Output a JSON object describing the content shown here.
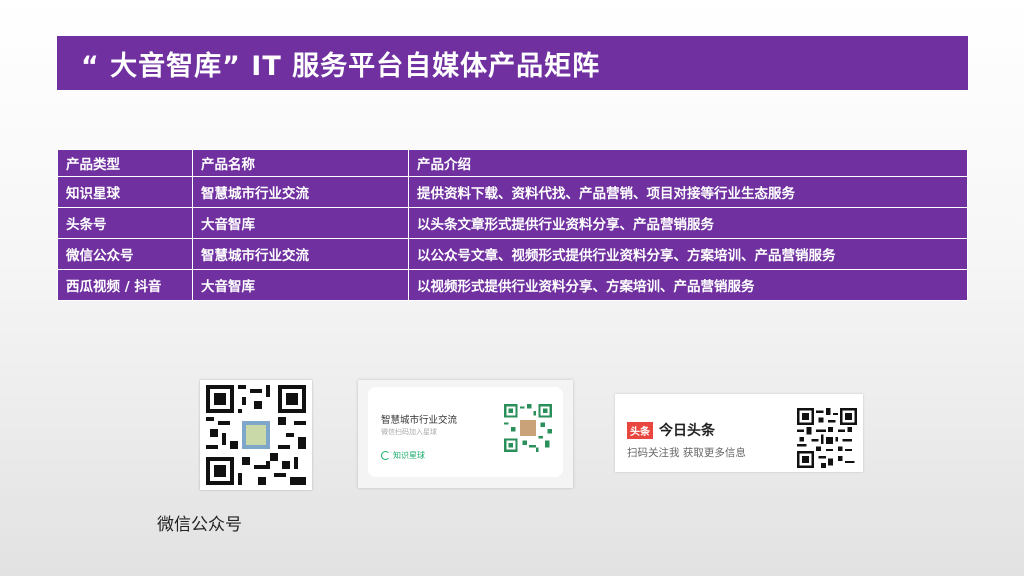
{
  "title": "“ 大音智库” IT 服务平台自媒体产品矩阵",
  "table": {
    "headers": [
      "产品类型",
      "产品名称",
      "产品介绍"
    ],
    "rows": [
      [
        "知识星球",
        "智慧城市行业交流",
        "提供资料下载、资料代找、产品营销、项目对接等行业生态服务"
      ],
      [
        "头条号",
        "大音智库",
        "以头条文章形式提供行业资料分享、产品营销服务"
      ],
      [
        "微信公众号",
        "智慧城市行业交流",
        "以公众号文章、视频形式提供行业资料分享、方案培训、产品营销服务"
      ],
      [
        "西瓜视频 / 抖音",
        "大音智库",
        "以视频形式提供行业资料分享、方案培训、产品营销服务"
      ]
    ]
  },
  "wechat": {
    "caption": "微信公众号"
  },
  "zsxq": {
    "title": "智慧城市行业交流",
    "subtitle": "微信扫码加入星球",
    "brand": "知识星球"
  },
  "toutiao": {
    "badge": "头条",
    "name": "今日头条",
    "subtitle": "扫码关注我 获取更多信息"
  },
  "colors": {
    "accent": "#7030a0",
    "toutiao_red": "#e8463f",
    "zsxq_green": "#1aad6a"
  }
}
